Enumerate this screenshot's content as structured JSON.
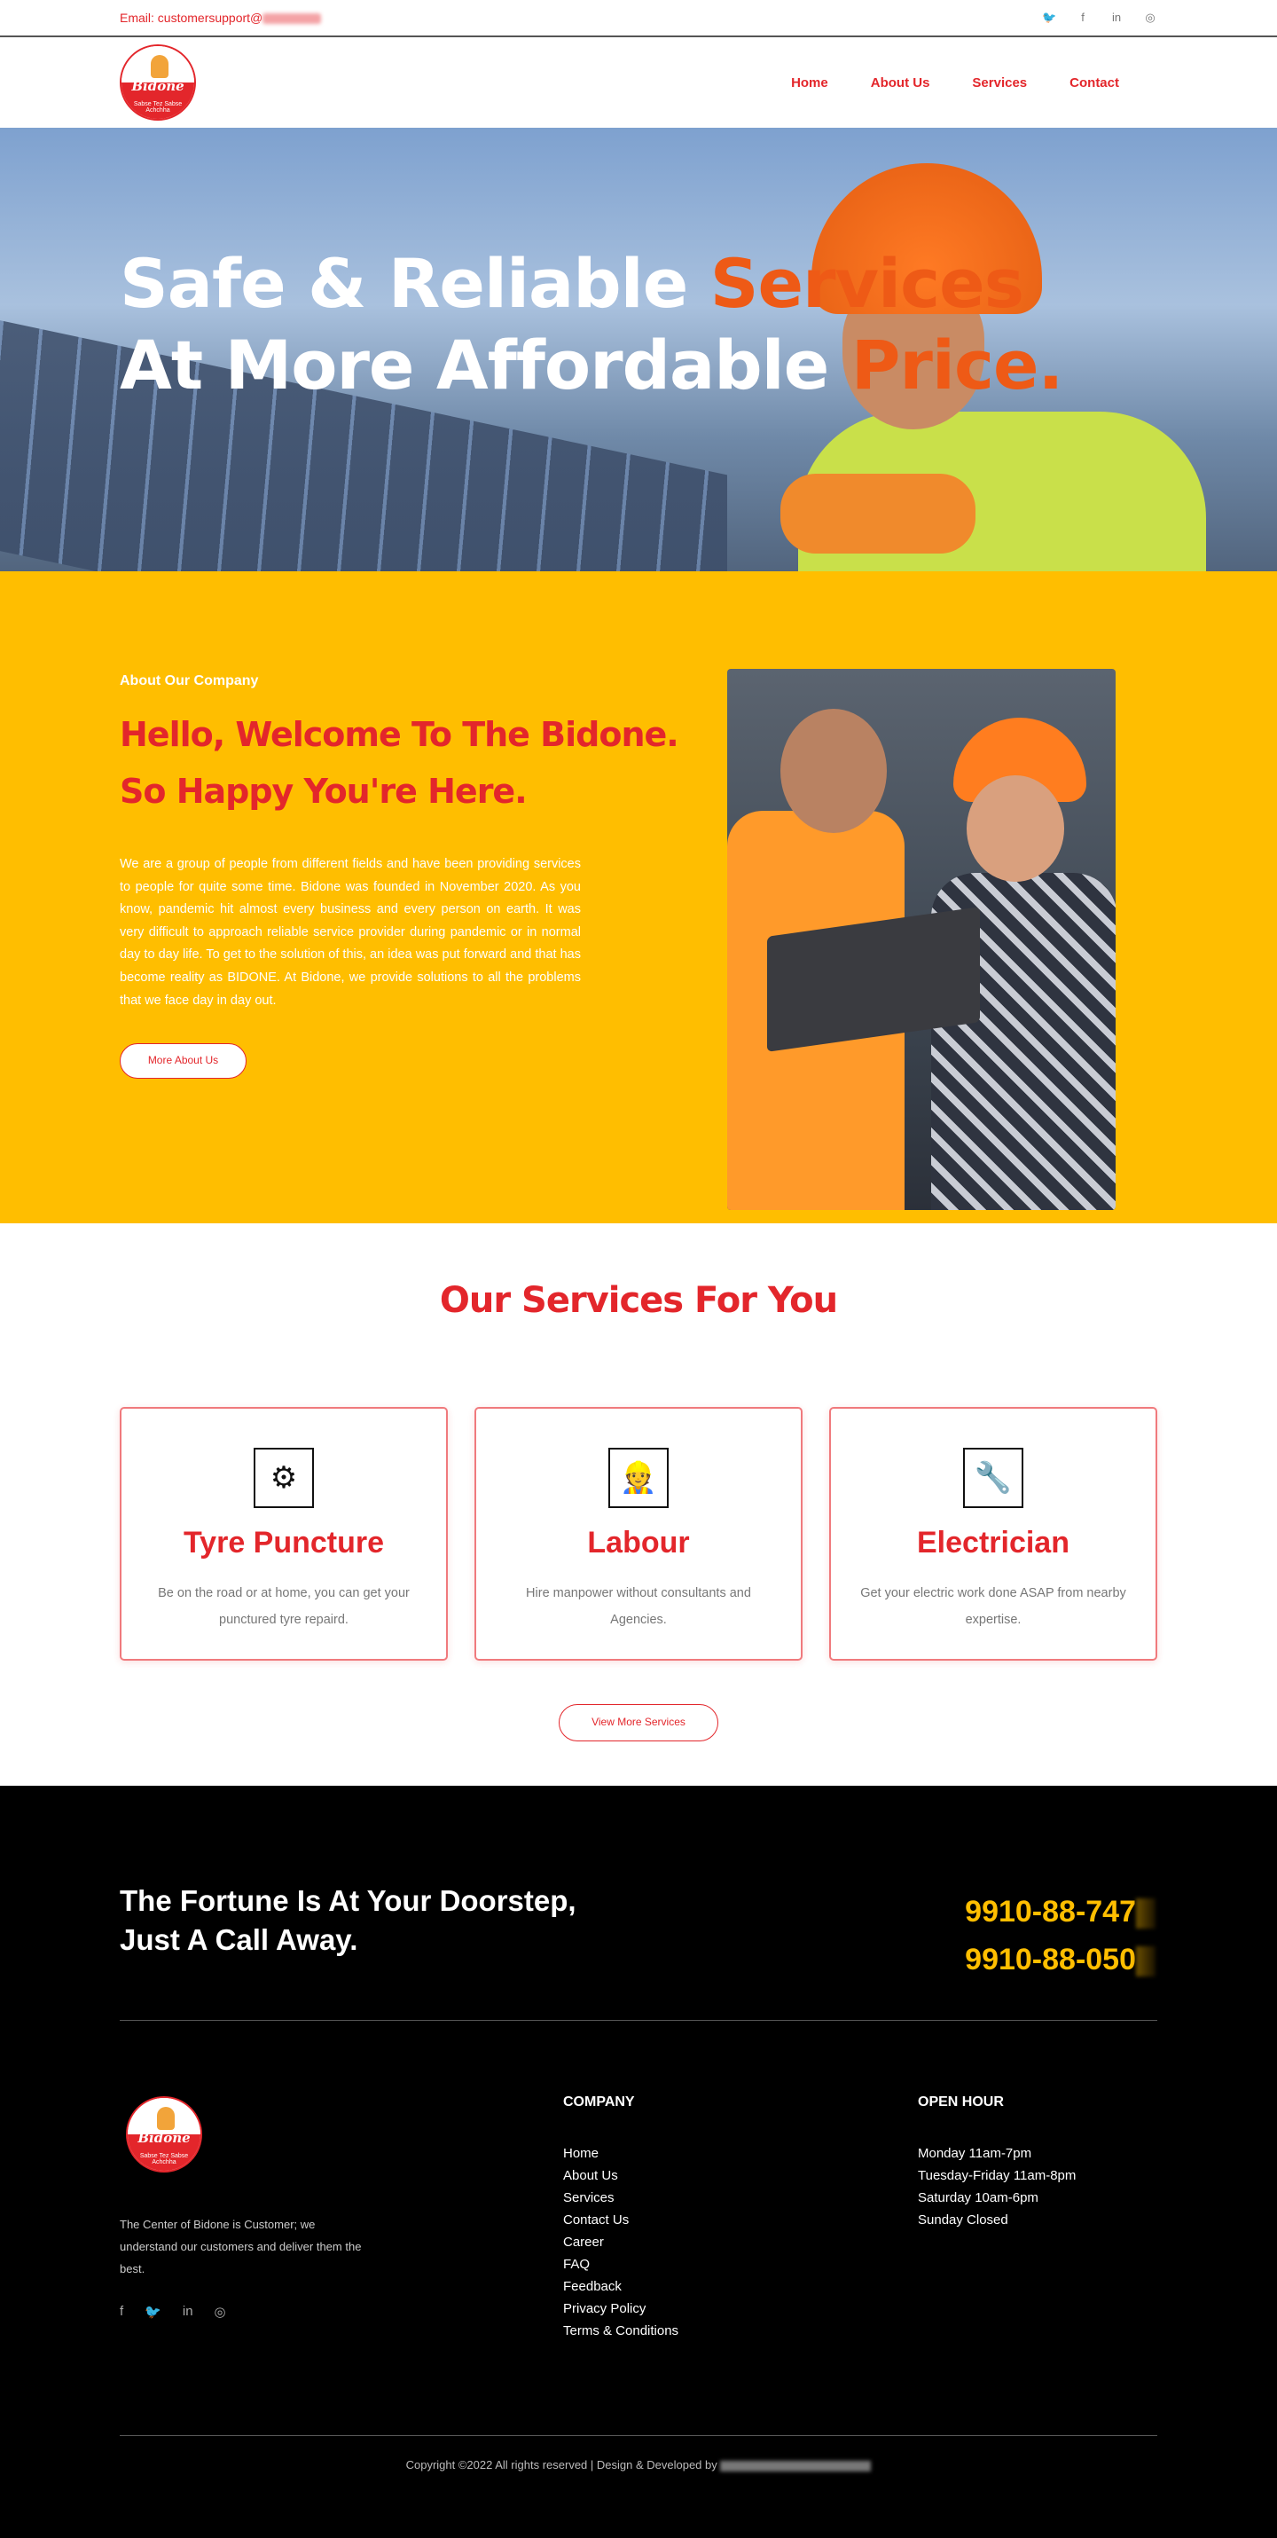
{
  "topbar": {
    "email_label": "Email: customersupport@",
    "socials": [
      {
        "icon": "twitter-icon",
        "glyph": "🐦"
      },
      {
        "icon": "facebook-icon",
        "glyph": "f"
      },
      {
        "icon": "linkedin-icon",
        "glyph": "in"
      },
      {
        "icon": "instagram-icon",
        "glyph": "◎"
      }
    ]
  },
  "header": {
    "logo_name": "Bidone",
    "logo_tagline": "Sabse Tez Sabse Achchha",
    "nav": [
      "Home",
      "About Us",
      "Services",
      "Contact"
    ]
  },
  "hero": {
    "line1_white": "Safe & Reliable ",
    "line1_highlight": "Services",
    "line2_white": "At More Affordable ",
    "line2_highlight": "Price."
  },
  "about": {
    "eyebrow": "About Our Company",
    "title_line1": "Hello, Welcome To The Bidone.",
    "title_line2": "So Happy You're Here.",
    "body": "We are a group of people from different fields and have been providing services to people for quite some time. Bidone was founded in November 2020. As you know, pandemic hit almost every business and every person on earth. It was very difficult to approach reliable service provider during pandemic or in normal day to day life. To get to the solution of this, an idea was put forward and that has become reality as BIDONE. At Bidone, we provide solutions to all the problems that we face day in day out.",
    "button": "More About Us"
  },
  "services": {
    "title": "Our Services For You",
    "cards": [
      {
        "icon": "tyre-icon",
        "glyph": "⚙",
        "title": "Tyre Puncture",
        "desc": "Be on the road or at home, you can get your punctured tyre repaird."
      },
      {
        "icon": "labour-icon",
        "glyph": "👷",
        "title": "Labour",
        "desc": "Hire manpower without consultants and Agencies."
      },
      {
        "icon": "electrician-icon",
        "glyph": "🔧",
        "title": "Electrician",
        "desc": "Get your electric work done ASAP from nearby expertise."
      }
    ],
    "button": "View More Services"
  },
  "footer": {
    "cta_line1": "The Fortune Is At Your Doorstep,",
    "cta_line2": "Just A Call Away.",
    "phone1": "9910-88-747",
    "phone2": "9910-88-050",
    "desc": "The Center of Bidone is Customer; we understand our customers and deliver them the best.",
    "socials": [
      {
        "icon": "facebook-icon",
        "glyph": "f"
      },
      {
        "icon": "twitter-icon",
        "glyph": "🐦"
      },
      {
        "icon": "linkedin-icon",
        "glyph": "in"
      },
      {
        "icon": "instagram-icon",
        "glyph": "◎"
      }
    ],
    "company_heading": "COMPANY",
    "company_links": [
      "Home",
      "About Us",
      "Services",
      "Contact Us",
      "Career",
      "FAQ",
      "Feedback",
      "Privacy Policy",
      "Terms & Conditions"
    ],
    "hours_heading": "OPEN HOUR",
    "hours": [
      "Monday 11am-7pm",
      "Tuesday-Friday 11am-8pm",
      "Saturday 10am-6pm",
      "Sunday Closed"
    ],
    "copyright": "Copyright ©2022 All rights reserved | Design & Developed by "
  },
  "colors": {
    "brand_red": "#e3262b",
    "brand_yellow": "#ffbe00",
    "hero_orange": "#ee5a16"
  }
}
